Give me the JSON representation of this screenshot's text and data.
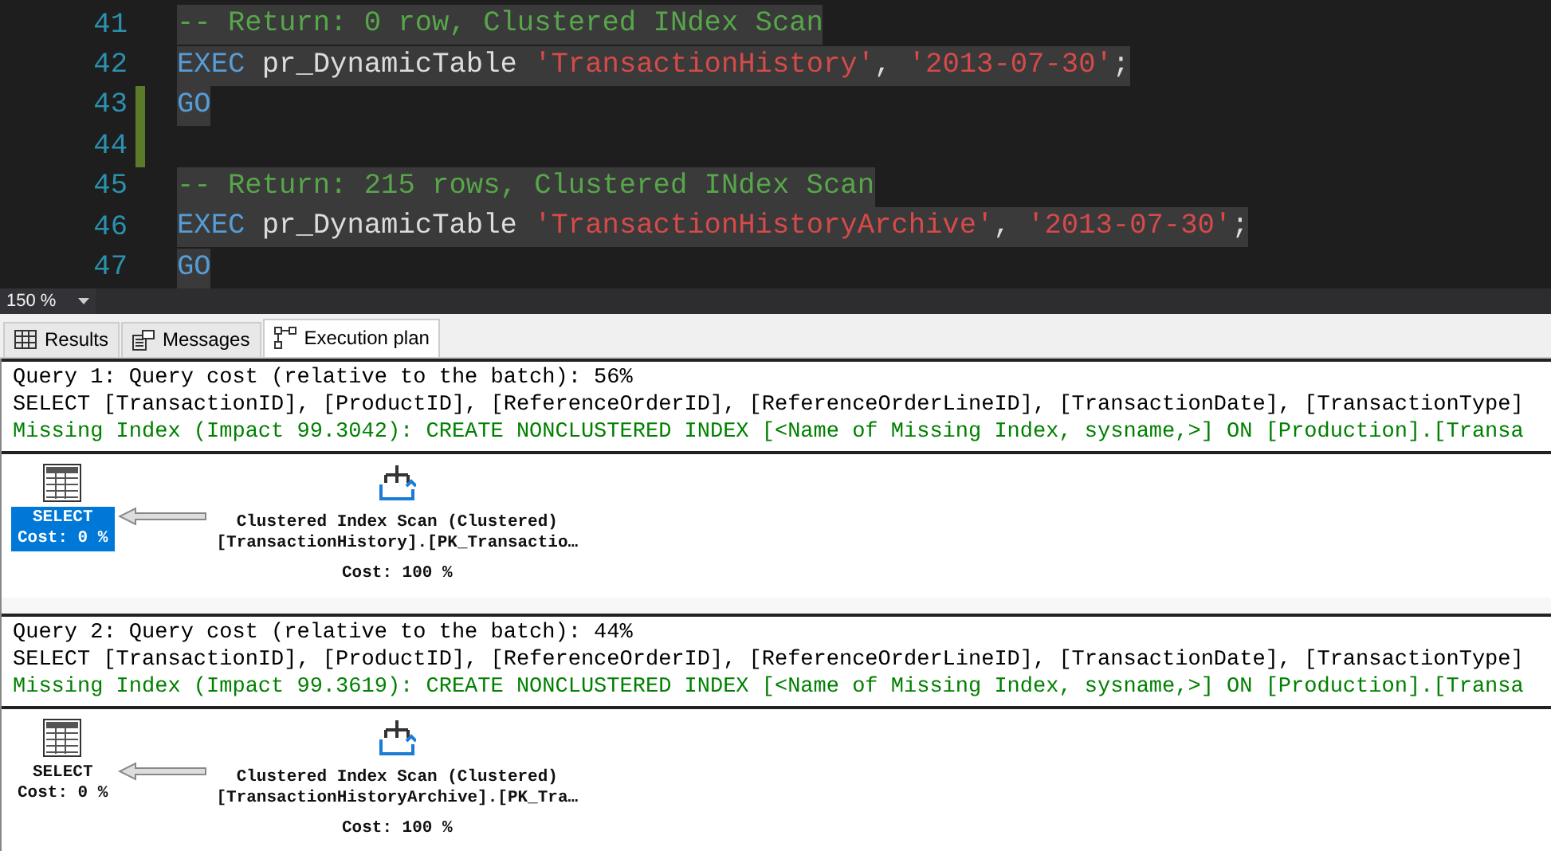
{
  "editor": {
    "lines": [
      {
        "number": "41",
        "changed": false,
        "tokens": [
          {
            "kind": "comment",
            "text": "-- Return: 0 row, Clustered INdex Scan"
          }
        ]
      },
      {
        "number": "42",
        "changed": false,
        "tokens": [
          {
            "kind": "keyword",
            "text": "EXEC"
          },
          {
            "kind": "plain",
            "text": " pr_DynamicTable "
          },
          {
            "kind": "string",
            "text": "'TransactionHistory'"
          },
          {
            "kind": "punct",
            "text": ", "
          },
          {
            "kind": "string",
            "text": "'2013-07-30'"
          },
          {
            "kind": "punct",
            "text": ";"
          }
        ]
      },
      {
        "number": "43",
        "changed": true,
        "tokens": [
          {
            "kind": "keyword",
            "text": "GO"
          }
        ]
      },
      {
        "number": "44",
        "changed": true
      },
      {
        "number": "45",
        "changed": false,
        "tokens": [
          {
            "kind": "comment",
            "text": "-- Return: 215 rows, Clustered INdex Scan"
          }
        ]
      },
      {
        "number": "46",
        "changed": false,
        "tokens": [
          {
            "kind": "keyword",
            "text": "EXEC"
          },
          {
            "kind": "plain",
            "text": " pr_DynamicTable "
          },
          {
            "kind": "string",
            "text": "'TransactionHistoryArchive'"
          },
          {
            "kind": "punct",
            "text": ", "
          },
          {
            "kind": "string",
            "text": "'2013-07-30'"
          },
          {
            "kind": "punct",
            "text": ";"
          }
        ]
      },
      {
        "number": "47",
        "changed": false,
        "tokens": [
          {
            "kind": "keyword",
            "text": "GO"
          }
        ]
      }
    ]
  },
  "zoom": {
    "value": "150 %"
  },
  "tabs": [
    {
      "label": "Results",
      "kind": "grid",
      "selected": false
    },
    {
      "label": "Messages",
      "kind": "messages",
      "selected": false
    },
    {
      "label": "Execution plan",
      "kind": "plan",
      "selected": true
    }
  ],
  "queries": [
    {
      "title": "Query 1: Query cost (relative to the batch): 56%",
      "statement": "SELECT [TransactionID], [ProductID], [ReferenceOrderID], [ReferenceOrderLineID], [TransactionDate], [TransactionType]",
      "missing_index": "Missing Index (Impact 99.3042): CREATE NONCLUSTERED INDEX [<Name of Missing Index, sysname,>] ON [Production].[Transa",
      "nodes": [
        {
          "kind": "select",
          "label": "SELECT",
          "cost": "Cost: 0 %",
          "selected": true
        },
        {
          "kind": "scan",
          "label": "Clustered Index Scan (Clustered)",
          "object": "[TransactionHistory].[PK_Transactio…",
          "cost": "Cost: 100 %",
          "selected": false
        }
      ]
    },
    {
      "title": "Query 2: Query cost (relative to the batch): 44%",
      "statement": "SELECT [TransactionID], [ProductID], [ReferenceOrderID], [ReferenceOrderLineID], [TransactionDate], [TransactionType]",
      "missing_index": "Missing Index (Impact 99.3619): CREATE NONCLUSTERED INDEX [<Name of Missing Index, sysname,>] ON [Production].[Transa",
      "nodes": [
        {
          "kind": "select",
          "label": "SELECT",
          "cost": "Cost: 0 %",
          "selected": false
        },
        {
          "kind": "scan",
          "label": "Clustered Index Scan (Clustered)",
          "object": "[TransactionHistoryArchive].[PK_Tra…",
          "cost": "Cost: 100 %",
          "selected": false
        }
      ]
    }
  ]
}
